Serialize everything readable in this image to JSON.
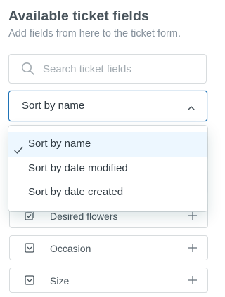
{
  "panel": {
    "title": "Available ticket fields",
    "subtitle": "Add fields from here to the ticket form."
  },
  "search": {
    "placeholder": "Search ticket fields",
    "value": ""
  },
  "sort": {
    "selected_label": "Sort by name",
    "options": [
      {
        "label": "Sort by name",
        "selected": true
      },
      {
        "label": "Sort by date modified",
        "selected": false
      },
      {
        "label": "Sort by date created",
        "selected": false
      }
    ]
  },
  "fields": [
    {
      "name": "Desired flowers",
      "icon": "multiselect-icon"
    },
    {
      "name": "Occasion",
      "icon": "dropdown-field-icon"
    },
    {
      "name": "Size",
      "icon": "dropdown-field-icon"
    }
  ],
  "colors": {
    "accent": "#1f73b7",
    "selected_option_bg": "#edf7ff",
    "text": "#2f3941",
    "muted": "#87929d"
  }
}
